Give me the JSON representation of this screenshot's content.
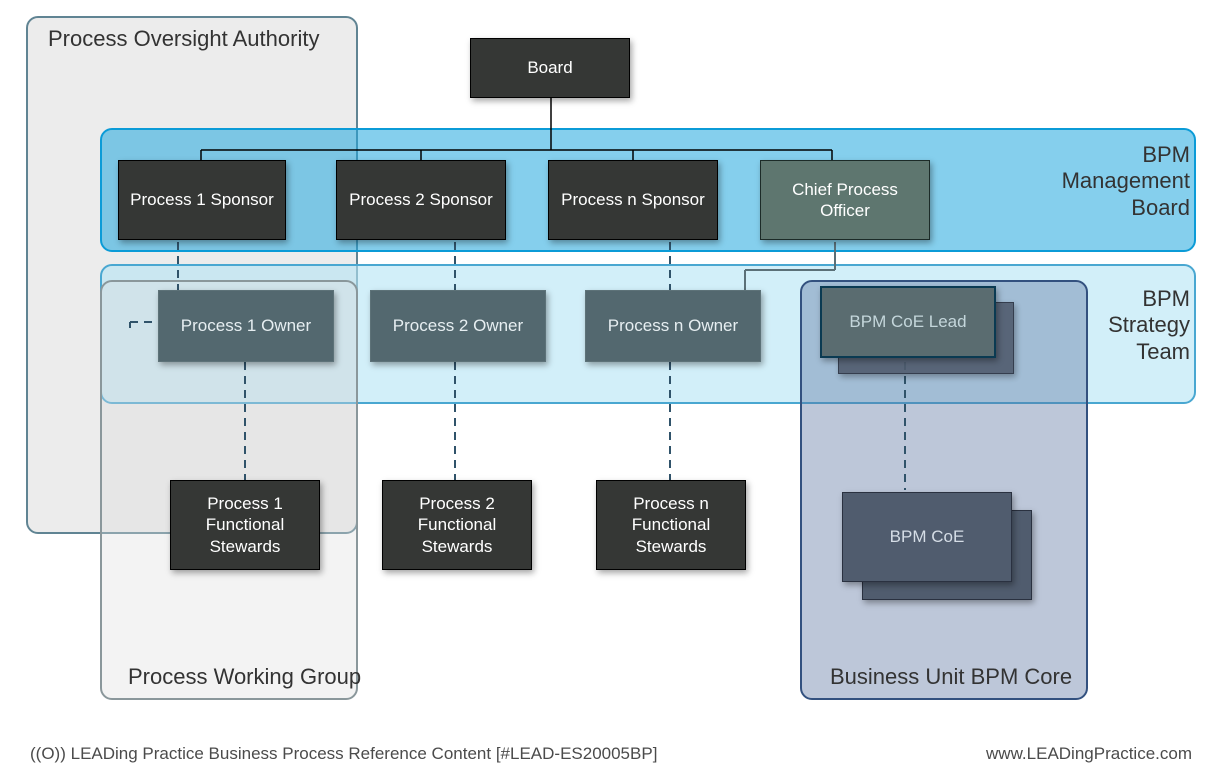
{
  "groups": {
    "oversight": "Process Oversight Authority",
    "management_board": "BPM Management Board",
    "strategy_team": "BPM Strategy Team",
    "working_group": "Process Working Group",
    "bpm_core": "Business Unit BPM Core"
  },
  "nodes": {
    "board": "Board",
    "sponsor1": "Process 1 Sponsor",
    "sponsor2": "Process 2 Sponsor",
    "sponsorn": "Process n Sponsor",
    "cpo": "Chief Process Officer",
    "owner1": "Process 1 Owner",
    "owner2": "Process 2 Owner",
    "ownern": "Process n Owner",
    "coe_lead": "BPM CoE Lead",
    "stewards1": "Process 1 Functional Stewards",
    "stewards2": "Process 2 Functional Stewards",
    "stewardsn": "Process n Functional Stewards",
    "bpm_coe": "BPM CoE"
  },
  "footer": {
    "left": "LEADing Practice Business Process Reference Content [#LEAD-ES20005BP]",
    "right": "www.LEADingPractice.com",
    "logo_prefix": "((O))"
  }
}
